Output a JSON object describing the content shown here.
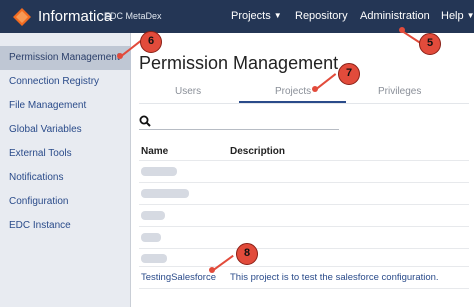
{
  "header": {
    "brand": "Informatica",
    "product": "EDC MetaDex",
    "nav": [
      {
        "label": "Projects",
        "has_caret": true
      },
      {
        "label": "Repository",
        "has_caret": false
      },
      {
        "label": "Administration",
        "has_caret": false
      },
      {
        "label": "Help",
        "has_caret": true
      }
    ],
    "colors": {
      "background": "#243655",
      "logo": "#f26b21"
    }
  },
  "sidebar": {
    "items": [
      {
        "label": "Permission Management",
        "active": true
      },
      {
        "label": "Connection Registry",
        "active": false
      },
      {
        "label": "File Management",
        "active": false
      },
      {
        "label": "Global Variables",
        "active": false
      },
      {
        "label": "External Tools",
        "active": false
      },
      {
        "label": "Notifications",
        "active": false
      },
      {
        "label": "Configuration",
        "active": false
      },
      {
        "label": "EDC Instance",
        "active": false
      }
    ]
  },
  "main": {
    "title": "Permission Management",
    "tabs": [
      {
        "label": "Users",
        "active": false
      },
      {
        "label": "Projects",
        "active": true
      },
      {
        "label": "Privileges",
        "active": false
      }
    ],
    "search_icon": "search-icon",
    "table": {
      "headers": [
        "Name",
        "Description"
      ],
      "visible_row": {
        "name": "TestingSalesforce",
        "description": "This project is to test the salesforce configuration."
      }
    }
  },
  "annotations": {
    "callouts": [
      "5",
      "6",
      "7",
      "8"
    ],
    "color": "#e24b3b"
  }
}
